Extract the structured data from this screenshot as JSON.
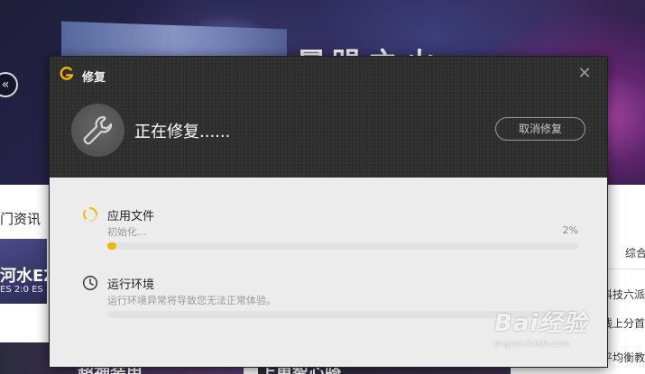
{
  "background": {
    "banner_title": "暴躁之火",
    "prev_arrow": "«",
    "hot_section_title": "门资讯",
    "card1_title": "河水EZ",
    "card1_subtitle": "ES 2:0 ES",
    "card2_title": "超神装甲",
    "card3_title": "上单智心骑",
    "tab_label": "综合",
    "list_items": [
      "科技六派",
      "线上分首",
      "平均衡教"
    ]
  },
  "watermark": {
    "main": "Bai经验",
    "url": "jingyan.baidu.com"
  },
  "dialog": {
    "title": "修复",
    "close_glyph": "✕",
    "status_text": "正在修复......",
    "cancel_label": "取消修复",
    "tasks": [
      {
        "title": "应用文件",
        "status": "初始化...",
        "percent_label": "2%",
        "progress": 0.02,
        "icon": "loading-spinner-icon"
      },
      {
        "title": "运行环境",
        "status": "运行环境异常将导致您无法正常体验。",
        "percent_label": "",
        "progress": 0,
        "icon": "clock-icon"
      }
    ]
  },
  "colors": {
    "accent": "#f5b400",
    "header_bg": "#2e2e2e",
    "body_bg": "#ececec"
  }
}
